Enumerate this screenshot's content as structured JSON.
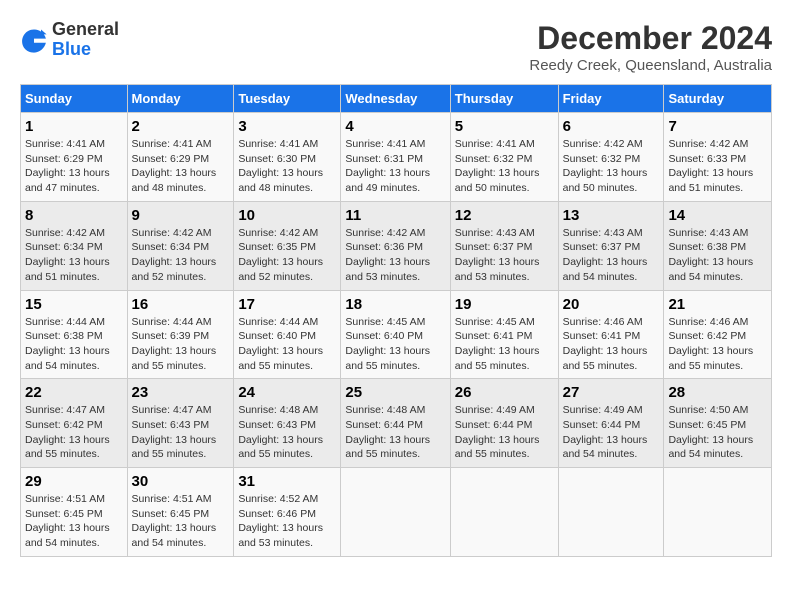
{
  "logo": {
    "general": "General",
    "blue": "Blue"
  },
  "title": "December 2024",
  "location": "Reedy Creek, Queensland, Australia",
  "days_of_week": [
    "Sunday",
    "Monday",
    "Tuesday",
    "Wednesday",
    "Thursday",
    "Friday",
    "Saturday"
  ],
  "weeks": [
    [
      {
        "day": "1",
        "sunrise": "4:41 AM",
        "sunset": "6:29 PM",
        "daylight": "13 hours and 47 minutes."
      },
      {
        "day": "2",
        "sunrise": "4:41 AM",
        "sunset": "6:29 PM",
        "daylight": "13 hours and 48 minutes."
      },
      {
        "day": "3",
        "sunrise": "4:41 AM",
        "sunset": "6:30 PM",
        "daylight": "13 hours and 48 minutes."
      },
      {
        "day": "4",
        "sunrise": "4:41 AM",
        "sunset": "6:31 PM",
        "daylight": "13 hours and 49 minutes."
      },
      {
        "day": "5",
        "sunrise": "4:41 AM",
        "sunset": "6:32 PM",
        "daylight": "13 hours and 50 minutes."
      },
      {
        "day": "6",
        "sunrise": "4:42 AM",
        "sunset": "6:32 PM",
        "daylight": "13 hours and 50 minutes."
      },
      {
        "day": "7",
        "sunrise": "4:42 AM",
        "sunset": "6:33 PM",
        "daylight": "13 hours and 51 minutes."
      }
    ],
    [
      {
        "day": "8",
        "sunrise": "4:42 AM",
        "sunset": "6:34 PM",
        "daylight": "13 hours and 51 minutes."
      },
      {
        "day": "9",
        "sunrise": "4:42 AM",
        "sunset": "6:34 PM",
        "daylight": "13 hours and 52 minutes."
      },
      {
        "day": "10",
        "sunrise": "4:42 AM",
        "sunset": "6:35 PM",
        "daylight": "13 hours and 52 minutes."
      },
      {
        "day": "11",
        "sunrise": "4:42 AM",
        "sunset": "6:36 PM",
        "daylight": "13 hours and 53 minutes."
      },
      {
        "day": "12",
        "sunrise": "4:43 AM",
        "sunset": "6:37 PM",
        "daylight": "13 hours and 53 minutes."
      },
      {
        "day": "13",
        "sunrise": "4:43 AM",
        "sunset": "6:37 PM",
        "daylight": "13 hours and 54 minutes."
      },
      {
        "day": "14",
        "sunrise": "4:43 AM",
        "sunset": "6:38 PM",
        "daylight": "13 hours and 54 minutes."
      }
    ],
    [
      {
        "day": "15",
        "sunrise": "4:44 AM",
        "sunset": "6:38 PM",
        "daylight": "13 hours and 54 minutes."
      },
      {
        "day": "16",
        "sunrise": "4:44 AM",
        "sunset": "6:39 PM",
        "daylight": "13 hours and 55 minutes."
      },
      {
        "day": "17",
        "sunrise": "4:44 AM",
        "sunset": "6:40 PM",
        "daylight": "13 hours and 55 minutes."
      },
      {
        "day": "18",
        "sunrise": "4:45 AM",
        "sunset": "6:40 PM",
        "daylight": "13 hours and 55 minutes."
      },
      {
        "day": "19",
        "sunrise": "4:45 AM",
        "sunset": "6:41 PM",
        "daylight": "13 hours and 55 minutes."
      },
      {
        "day": "20",
        "sunrise": "4:46 AM",
        "sunset": "6:41 PM",
        "daylight": "13 hours and 55 minutes."
      },
      {
        "day": "21",
        "sunrise": "4:46 AM",
        "sunset": "6:42 PM",
        "daylight": "13 hours and 55 minutes."
      }
    ],
    [
      {
        "day": "22",
        "sunrise": "4:47 AM",
        "sunset": "6:42 PM",
        "daylight": "13 hours and 55 minutes."
      },
      {
        "day": "23",
        "sunrise": "4:47 AM",
        "sunset": "6:43 PM",
        "daylight": "13 hours and 55 minutes."
      },
      {
        "day": "24",
        "sunrise": "4:48 AM",
        "sunset": "6:43 PM",
        "daylight": "13 hours and 55 minutes."
      },
      {
        "day": "25",
        "sunrise": "4:48 AM",
        "sunset": "6:44 PM",
        "daylight": "13 hours and 55 minutes."
      },
      {
        "day": "26",
        "sunrise": "4:49 AM",
        "sunset": "6:44 PM",
        "daylight": "13 hours and 55 minutes."
      },
      {
        "day": "27",
        "sunrise": "4:49 AM",
        "sunset": "6:44 PM",
        "daylight": "13 hours and 54 minutes."
      },
      {
        "day": "28",
        "sunrise": "4:50 AM",
        "sunset": "6:45 PM",
        "daylight": "13 hours and 54 minutes."
      }
    ],
    [
      {
        "day": "29",
        "sunrise": "4:51 AM",
        "sunset": "6:45 PM",
        "daylight": "13 hours and 54 minutes."
      },
      {
        "day": "30",
        "sunrise": "4:51 AM",
        "sunset": "6:45 PM",
        "daylight": "13 hours and 54 minutes."
      },
      {
        "day": "31",
        "sunrise": "4:52 AM",
        "sunset": "6:46 PM",
        "daylight": "13 hours and 53 minutes."
      },
      null,
      null,
      null,
      null
    ]
  ]
}
